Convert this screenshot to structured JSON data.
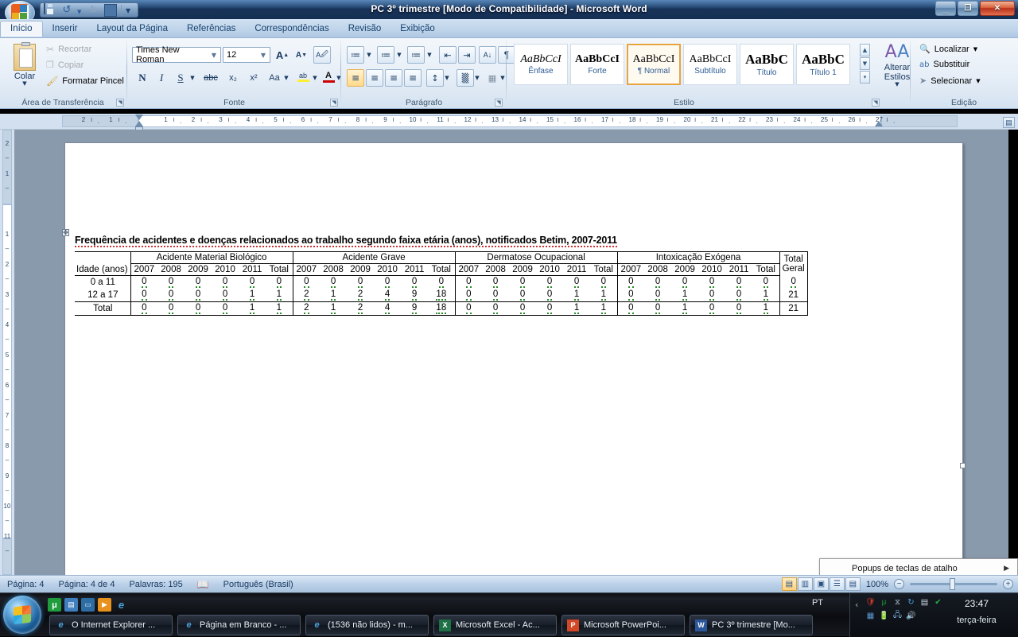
{
  "window": {
    "title": "PC 3º trimestre [Modo de Compatibilidade]  -  Microsoft Word",
    "minimize_label": "—",
    "restore_label": "❐",
    "close_label": "✕"
  },
  "quick_access": {
    "office_button": "office-orb",
    "items": [
      {
        "name": "save",
        "glyph": "save-icon"
      },
      {
        "name": "undo",
        "glyph": "↺"
      },
      {
        "name": "undo-dropdown",
        "glyph": "▾"
      },
      {
        "name": "redo",
        "glyph": "↻"
      },
      {
        "name": "print-preview",
        "glyph": "print-icon"
      },
      {
        "name": "customize",
        "glyph": "▾"
      }
    ]
  },
  "ribbon": {
    "tabs": [
      {
        "label": "Início",
        "active": true
      },
      {
        "label": "Inserir",
        "active": false
      },
      {
        "label": "Layout da Página",
        "active": false
      },
      {
        "label": "Referências",
        "active": false
      },
      {
        "label": "Correspondências",
        "active": false
      },
      {
        "label": "Revisão",
        "active": false
      },
      {
        "label": "Exibição",
        "active": false
      }
    ],
    "clipboard": {
      "group_label": "Área de Transferência",
      "paste_label": "Colar",
      "cut_label": "Recortar",
      "copy_label": "Copiar",
      "format_painter_label": "Formatar Pincel"
    },
    "font": {
      "group_label": "Fonte",
      "font_name": "Times New Roman",
      "font_size": "12",
      "grow_font": "A",
      "shrink_font": "A",
      "clear_formatting": "Aa",
      "bold": "N",
      "italic": "I",
      "underline": "S",
      "strikethrough": "abc",
      "subscript": "x₂",
      "superscript": "x²",
      "change_case": "Aa",
      "highlight": "ab",
      "font_color": "A"
    },
    "paragraph": {
      "group_label": "Parágrafo",
      "bullets": "≔",
      "numbering": "≔",
      "multilevel": "≔",
      "decrease_indent": "⇤",
      "increase_indent": "⇥",
      "sort": "A↓",
      "show_marks": "¶",
      "align_left": "≡",
      "align_center": "≡",
      "align_right": "≡",
      "justify": "≡",
      "line_spacing": "↕",
      "shading": "▒",
      "borders": "▦"
    },
    "styles": {
      "group_label": "Estilo",
      "items": [
        {
          "sample": "AaBbCcI",
          "name": "Ênfase",
          "italic": true,
          "bold": false,
          "selected": false
        },
        {
          "sample": "AaBbCcI",
          "name": "Forte",
          "italic": false,
          "bold": true,
          "selected": false
        },
        {
          "sample": "AaBbCcI",
          "name": "¶ Normal",
          "italic": false,
          "bold": false,
          "selected": true
        },
        {
          "sample": "AaBbCcI",
          "name": "Subtítulo",
          "italic": false,
          "bold": false,
          "selected": false
        },
        {
          "sample": "AaBbC",
          "name": "Título",
          "italic": false,
          "bold": true,
          "selected": false
        },
        {
          "sample": "AaBbC",
          "name": "Título 1",
          "italic": false,
          "bold": true,
          "selected": false
        }
      ],
      "change_styles_label": "Alterar Estilos"
    },
    "editing": {
      "group_label": "Edição",
      "find_label": "Localizar",
      "replace_label": "Substituir",
      "select_label": "Selecionar"
    }
  },
  "ruler": {
    "horizontal_ticks": "2 . 1 . 1 . 2 . 3 . 4 . 5 . 6 . 7 . 8 . 9 . 10 . 11 . 12 . 13 . 14 . 15 . 16 . 17 . 18 . 19 . 20 . 21 . 22 . 23 . 24 . 25 . 26 . 27",
    "tab_selector": "L",
    "h_labels": [
      "2",
      "1",
      "1",
      "2",
      "3",
      "4",
      "5",
      "6",
      "7",
      "8",
      "9",
      "10",
      "11",
      "12",
      "13",
      "14",
      "15",
      "16",
      "17",
      "18",
      "19",
      "20",
      "21",
      "22",
      "23",
      "24",
      "25",
      "26",
      "27"
    ],
    "v_labels": [
      "2",
      "1",
      "1",
      "2",
      "3",
      "4",
      "5",
      "6",
      "7",
      "8",
      "9",
      "10",
      "11"
    ]
  },
  "document": {
    "title": "Frequência de acidentes e doenças relacionados ao trabalho segundo faixa etária (anos), notificados Betim, 2007-2011",
    "table": {
      "row_header_label": "Idade (anos)",
      "groups": [
        {
          "label": "Acidente Material Biológico"
        },
        {
          "label": "Acidente Grave"
        },
        {
          "label": "Dermatose Ocupacional"
        },
        {
          "label": "Intoxicação Exógena"
        }
      ],
      "year_columns": [
        "2007",
        "2008",
        "2009",
        "2010",
        "2011",
        "Total"
      ],
      "grand_total_label_line1": "Total",
      "grand_total_label_line2": "Geral",
      "rows": [
        {
          "label": "0 a 11",
          "bold": false,
          "values": [
            [
              "0",
              "0",
              "0",
              "0",
              "0",
              "0"
            ],
            [
              "0",
              "0",
              "0",
              "0",
              "0",
              "0"
            ],
            [
              "0",
              "0",
              "0",
              "0",
              "0",
              "0"
            ],
            [
              "0",
              "0",
              "0",
              "0",
              "0",
              "0"
            ]
          ],
          "total": "0"
        },
        {
          "label": "12 a 17",
          "bold": false,
          "values": [
            [
              "0",
              "0",
              "0",
              "0",
              "1",
              "1"
            ],
            [
              "2",
              "1",
              "2",
              "4",
              "9",
              "18"
            ],
            [
              "0",
              "0",
              "0",
              "0",
              "1",
              "1"
            ],
            [
              "0",
              "0",
              "1",
              "0",
              "0",
              "1"
            ]
          ],
          "total": "21"
        },
        {
          "label": "Total",
          "bold": true,
          "values": [
            [
              "0",
              "0",
              "0",
              "0",
              "1",
              "1"
            ],
            [
              "2",
              "1",
              "2",
              "4",
              "9",
              "18"
            ],
            [
              "0",
              "0",
              "0",
              "0",
              "1",
              "1"
            ],
            [
              "0",
              "0",
              "1",
              "0",
              "0",
              "1"
            ]
          ],
          "total": "21"
        }
      ]
    }
  },
  "status_bar": {
    "page": "Página: 4",
    "page_of": "Página: 4 de 4",
    "words": "Palavras: 195",
    "proofing_icon": "spelling-check-icon",
    "language": "Português (Brasil)",
    "views": [
      {
        "name": "print-layout",
        "glyph": "▤",
        "active": true
      },
      {
        "name": "full-screen-reading",
        "glyph": "▥",
        "active": false
      },
      {
        "name": "web-layout",
        "glyph": "▣",
        "active": false
      },
      {
        "name": "outline",
        "glyph": "☰",
        "active": false
      },
      {
        "name": "draft",
        "glyph": "▤",
        "active": false
      }
    ],
    "zoom": "100%",
    "zoom_out": "−",
    "zoom_in": "+"
  },
  "popup": {
    "label": "Popups de teclas de atalho",
    "submenu_arrow": "▶"
  },
  "taskbar": {
    "start_label": "start-orb",
    "quick_launch": [
      {
        "name": "utorrent",
        "glyph": "μ"
      },
      {
        "name": "restore-window",
        "glyph": "🗗"
      },
      {
        "name": "show-desktop",
        "glyph": "▭"
      },
      {
        "name": "media-player",
        "glyph": "▶"
      },
      {
        "name": "internet-explorer",
        "glyph": "e"
      }
    ],
    "tasks": [
      {
        "icon": "ie-icon",
        "label": "O Internet Explorer ..."
      },
      {
        "icon": "ie-icon",
        "label": "Página em Branco - ..."
      },
      {
        "icon": "ie-icon",
        "label": "(1536 não lidos) - m..."
      },
      {
        "icon": "excel-icon",
        "label": "Microsoft Excel - Ac..."
      },
      {
        "icon": "powerpoint-icon",
        "label": "Microsoft PowerPoi..."
      },
      {
        "icon": "word-icon",
        "label": "PC 3º trimestre [Mo..."
      }
    ],
    "tray": {
      "expand_arrow": "‹",
      "language": "PT",
      "icons": [
        {
          "name": "antivirus-icon",
          "glyph": "🛡"
        },
        {
          "name": "utorrent-tray-icon",
          "glyph": "μ"
        },
        {
          "name": "hourglass-icon",
          "glyph": "⧖"
        },
        {
          "name": "sync-icon",
          "glyph": "↻"
        },
        {
          "name": "document-icon",
          "glyph": "▤"
        },
        {
          "name": "shield-ok-icon",
          "glyph": "✔"
        },
        {
          "name": "calculator-icon",
          "glyph": "▦"
        },
        {
          "name": "battery-icon",
          "glyph": "🔋"
        },
        {
          "name": "network-icon",
          "glyph": "🖧"
        },
        {
          "name": "volume-icon",
          "glyph": "🔊"
        }
      ],
      "time": "23:47",
      "day": "terça-feira"
    }
  }
}
